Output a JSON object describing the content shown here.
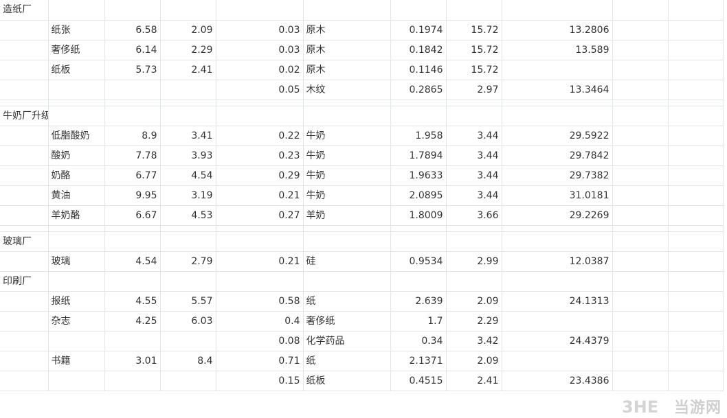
{
  "rows": [
    {
      "kind": "r",
      "c": [
        "造纸厂",
        "",
        "",
        "",
        "",
        "",
        "",
        "",
        "",
        "",
        "",
        ""
      ]
    },
    {
      "kind": "r",
      "c": [
        "",
        "纸张",
        "6.58",
        "2.09",
        "0.03",
        "原木",
        "0.1974",
        "15.72",
        "",
        "13.2806",
        "",
        ""
      ]
    },
    {
      "kind": "r",
      "c": [
        "",
        "奢侈纸",
        "6.14",
        "2.29",
        "0.03",
        "原木",
        "0.1842",
        "15.72",
        "",
        "13.589",
        "",
        ""
      ]
    },
    {
      "kind": "r",
      "c": [
        "",
        "纸板",
        "5.73",
        "2.41",
        "0.02",
        "原木",
        "0.1146",
        "15.72",
        "",
        "",
        "",
        ""
      ]
    },
    {
      "kind": "r",
      "c": [
        "",
        "",
        "",
        "",
        "0.05",
        "木纹",
        "0.2865",
        "2.97",
        "",
        "13.3464",
        "",
        ""
      ]
    },
    {
      "kind": "s"
    },
    {
      "kind": "r",
      "c": [
        "牛奶厂升级后",
        "",
        "",
        "",
        "",
        "",
        "",
        "",
        "",
        "",
        "",
        ""
      ]
    },
    {
      "kind": "r",
      "c": [
        "",
        "低脂酸奶",
        "8.9",
        "3.41",
        "0.22",
        "牛奶",
        "1.958",
        "3.44",
        "",
        "29.5922",
        "",
        ""
      ]
    },
    {
      "kind": "r",
      "c": [
        "",
        "酸奶",
        "7.78",
        "3.93",
        "0.23",
        "牛奶",
        "1.7894",
        "3.44",
        "",
        "29.7842",
        "",
        ""
      ]
    },
    {
      "kind": "r",
      "c": [
        "",
        "奶酪",
        "6.77",
        "4.54",
        "0.29",
        "牛奶",
        "1.9633",
        "3.44",
        "",
        "29.7382",
        "",
        ""
      ]
    },
    {
      "kind": "r",
      "c": [
        "",
        "黄油",
        "9.95",
        "3.19",
        "0.21",
        "牛奶",
        "2.0895",
        "3.44",
        "",
        "31.0181",
        "",
        ""
      ]
    },
    {
      "kind": "r",
      "c": [
        "",
        "羊奶酪",
        "6.67",
        "4.53",
        "0.27",
        "羊奶",
        "1.8009",
        "3.66",
        "",
        "29.2269",
        "",
        ""
      ]
    },
    {
      "kind": "s"
    },
    {
      "kind": "r",
      "c": [
        "玻璃厂",
        "",
        "",
        "",
        "",
        "",
        "",
        "",
        "",
        "",
        "",
        ""
      ]
    },
    {
      "kind": "r",
      "c": [
        "",
        "玻璃",
        "4.54",
        "2.79",
        "0.21",
        "硅",
        "0.9534",
        "2.99",
        "",
        "12.0387",
        "",
        ""
      ]
    },
    {
      "kind": "r",
      "c": [
        "印刷厂",
        "",
        "",
        "",
        "",
        "",
        "",
        "",
        "",
        "",
        "",
        ""
      ]
    },
    {
      "kind": "r",
      "c": [
        "",
        "报纸",
        "4.55",
        "5.57",
        "0.58",
        "纸",
        "2.639",
        "2.09",
        "",
        "24.1313",
        "",
        ""
      ]
    },
    {
      "kind": "r",
      "c": [
        "",
        "杂志",
        "4.25",
        "6.03",
        "0.4",
        "奢侈纸",
        "1.7",
        "2.29",
        "",
        "",
        "",
        ""
      ]
    },
    {
      "kind": "r",
      "c": [
        "",
        "",
        "",
        "",
        "0.08",
        "化学药品",
        "0.34",
        "3.42",
        "",
        "24.4379",
        "",
        ""
      ]
    },
    {
      "kind": "r",
      "c": [
        "",
        "书籍",
        "3.01",
        "8.4",
        "0.71",
        "纸",
        "2.1371",
        "2.09",
        "",
        "",
        "",
        ""
      ]
    },
    {
      "kind": "r",
      "c": [
        "",
        "",
        "",
        "",
        "0.15",
        "纸板",
        "0.4515",
        "2.41",
        "",
        "23.4386",
        "",
        ""
      ]
    }
  ],
  "watermark": {
    "logo": "3HE",
    "text": "当游网"
  }
}
